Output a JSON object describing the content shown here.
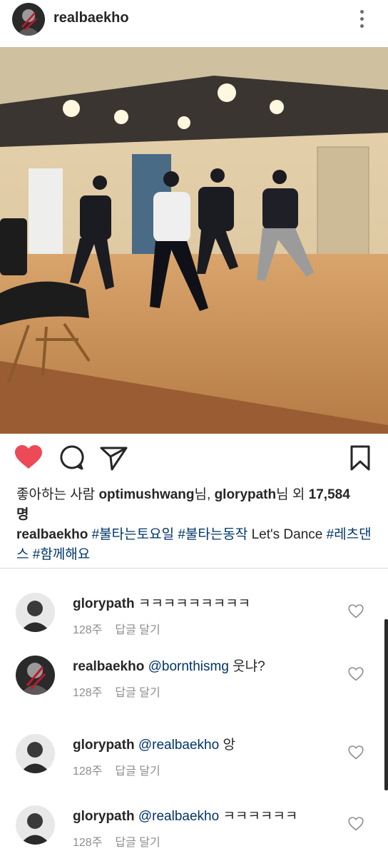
{
  "post": {
    "username": "realbaekho",
    "avatar_icon": "user-avatar-icon",
    "more_icon": "more-options-icon"
  },
  "actions": {
    "like_icon": "heart-filled-icon",
    "comment_icon": "comment-icon",
    "share_icon": "send-icon",
    "save_icon": "bookmark-icon",
    "like_color": "#ed4956"
  },
  "likes": {
    "prefix": "좋아하는 사람 ",
    "user1": "optimushwang",
    "sep1": "님, ",
    "user2": "glorypath",
    "sep2": "님 외 ",
    "count": "17,584",
    "suffix": "명"
  },
  "caption": {
    "username": "realbaekho",
    "tag1": "#불타는토요일",
    "tag2": "#불타는동작",
    "text": "Let's Dance",
    "tag3": "#레츠댄스",
    "tag4": "#함께해요"
  },
  "comments": [
    {
      "username": "glorypath",
      "mention": "",
      "text": "ㅋㅋㅋㅋㅋㅋㅋㅋㅋ",
      "time": "128주",
      "reply": "답글 달기"
    },
    {
      "username": "realbaekho",
      "mention": "@bornthismg",
      "text": "웃냐?",
      "time": "128주",
      "reply": "답글 달기"
    },
    {
      "username": "glorypath",
      "mention": "@realbaekho",
      "text": "앙",
      "time": "128주",
      "reply": "답글 달기"
    },
    {
      "username": "glorypath",
      "mention": "@realbaekho",
      "text": "ㅋㅋㅋㅋㅋㅋ",
      "time": "128주",
      "reply": "답글 달기"
    }
  ]
}
